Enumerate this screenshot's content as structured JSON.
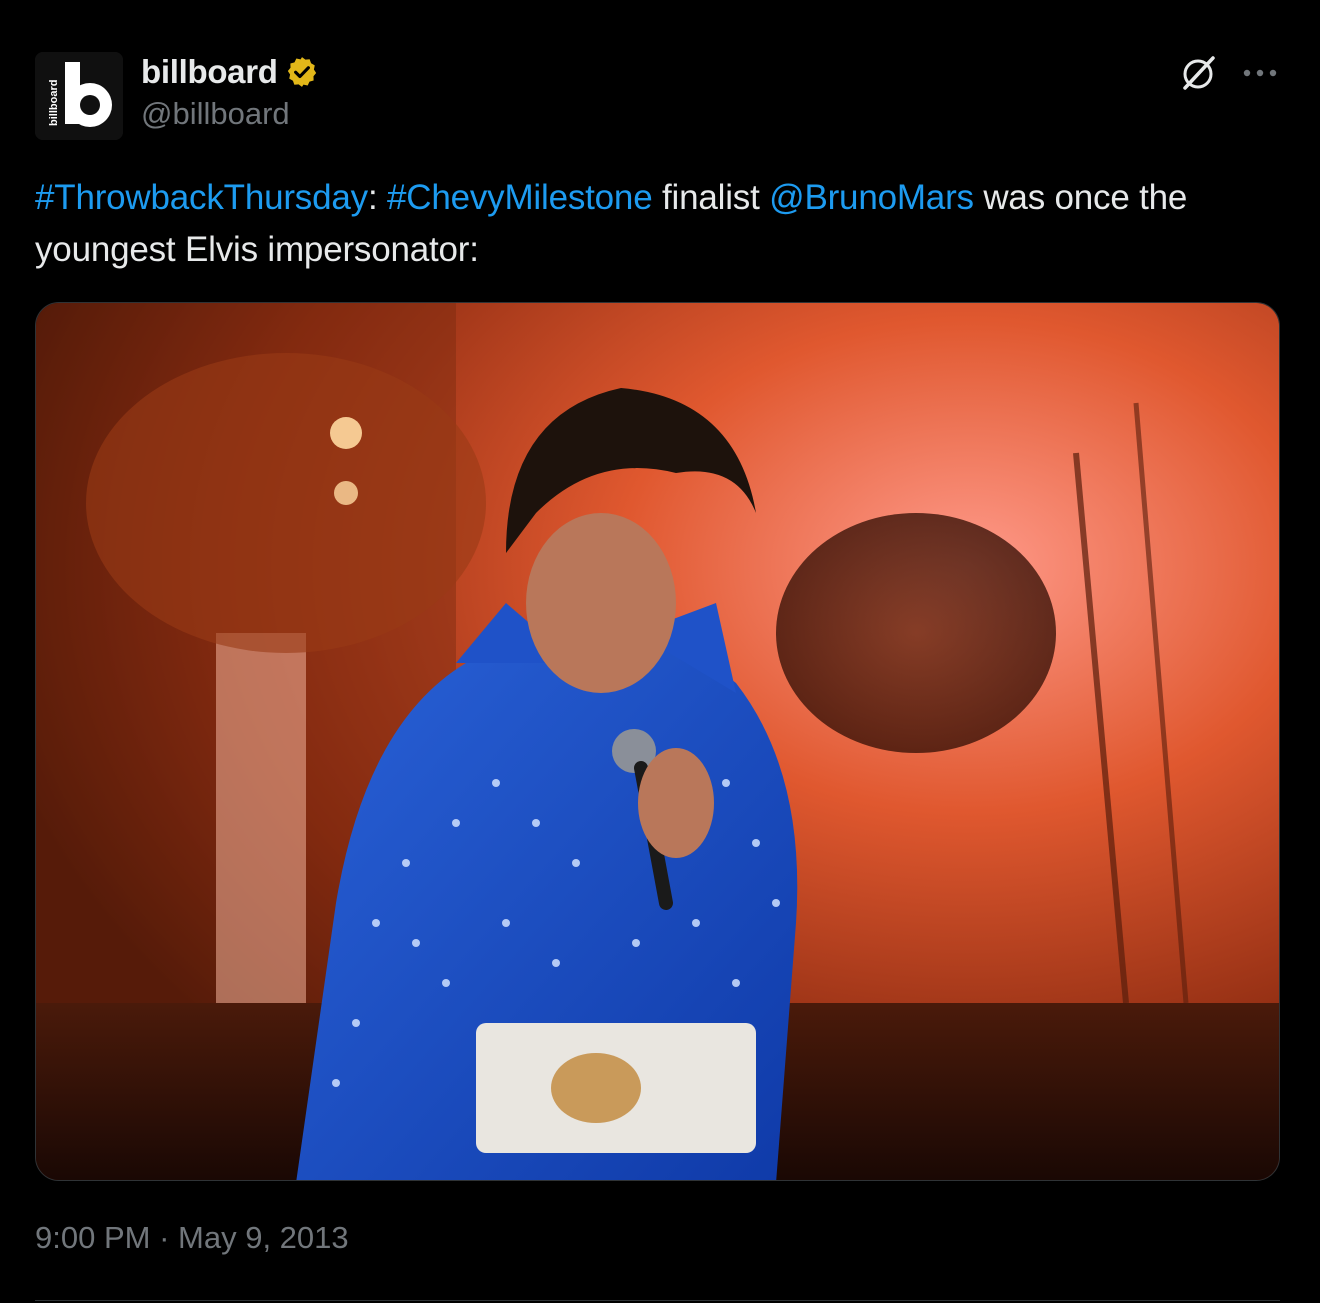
{
  "account": {
    "display_name": "billboard",
    "handle": "@billboard",
    "avatar_letter": "b",
    "avatar_wordmark": "billboard",
    "verified_color": "#e2b719"
  },
  "tweet": {
    "segments": [
      {
        "text": "#ThrowbackThursday",
        "type": "hashtag"
      },
      {
        "text": ": ",
        "type": "text"
      },
      {
        "text": "#ChevyMilestone",
        "type": "hashtag"
      },
      {
        "text": " finalist ",
        "type": "text"
      },
      {
        "text": "@BrunoMars",
        "type": "mention"
      },
      {
        "text": " was once the youngest Elvis impersonator:",
        "type": "text"
      }
    ],
    "time": "9:00 PM",
    "separator": "·",
    "date": "May 9, 2013"
  },
  "colors": {
    "background": "#000000",
    "link": "#1d9bf0",
    "text": "#e7e9ea",
    "muted": "#71767b"
  },
  "icons": {
    "grok": "grok-icon",
    "more": "more-icon",
    "verified": "verified-badge-icon"
  }
}
